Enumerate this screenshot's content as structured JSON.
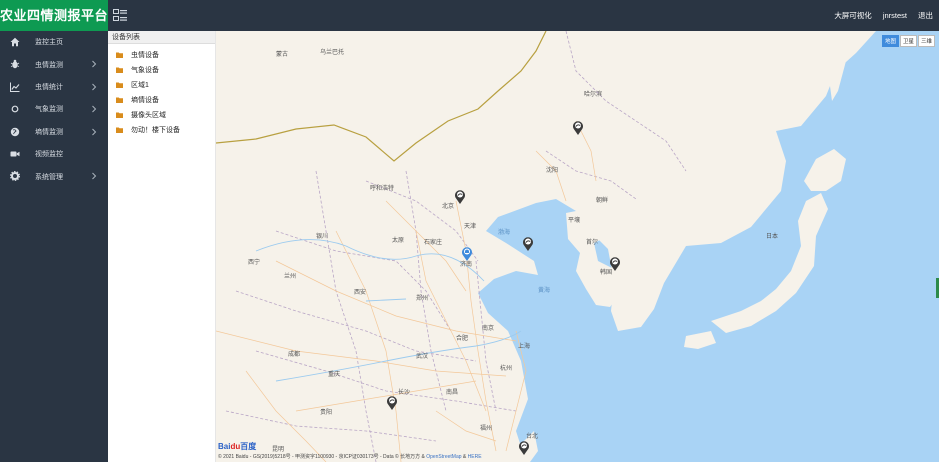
{
  "brand": {
    "title": "农业四情测报平台"
  },
  "header": {
    "links": [
      "大屏可视化",
      "jnrstest",
      "退出"
    ]
  },
  "sidebar": {
    "items": [
      {
        "label": "监控主页",
        "icon": "home-icon",
        "has_submenu": false
      },
      {
        "label": "虫情监测",
        "icon": "bug-icon",
        "has_submenu": true
      },
      {
        "label": "虫情统计",
        "icon": "line-chart-icon",
        "has_submenu": true
      },
      {
        "label": "气象监测",
        "icon": "sun-icon",
        "has_submenu": true
      },
      {
        "label": "墒情监测",
        "icon": "globe-icon",
        "has_submenu": true
      },
      {
        "label": "视频监控",
        "icon": "video-camera-icon",
        "has_submenu": false
      },
      {
        "label": "系统管理",
        "icon": "gear-icon",
        "has_submenu": true
      }
    ]
  },
  "device_panel": {
    "title": "设备列表",
    "items": [
      "虫情设备",
      "气象设备",
      "区域1",
      "墒情设备",
      "摄像头区域",
      "勿动！楼下设备"
    ]
  },
  "map": {
    "map_types": [
      "地图",
      "卫星",
      "三维"
    ],
    "active_map_type": "地图",
    "labels": {
      "cities": [
        "蒙古",
        "乌兰巴托",
        "哈尔滨",
        "沈阳",
        "呼和浩特",
        "北京",
        "天津",
        "朝鲜",
        "韩国",
        "日本",
        "太原",
        "石家庄",
        "银川",
        "西宁",
        "兰州",
        "济南",
        "西安",
        "郑州",
        "合肥",
        "南京",
        "上海",
        "成都",
        "武汉",
        "杭州",
        "重庆",
        "长沙",
        "南昌",
        "贵阳",
        "福州",
        "昆明",
        "台北",
        "平壤",
        "首尔"
      ],
      "seas": [
        "渤海",
        "黄海"
      ]
    },
    "copyright": "© 2021 Baidu - GS(2019)5218号 - 甲测资字1100930 - 京ICP证030173号 - Data © 长地万方 & ",
    "copyright_osm": "OpenStreetMap",
    "copyright_and": " & ",
    "copyright_here": "HERE",
    "baidu_logo_a": "Bai",
    "baidu_logo_b": "du",
    "baidu_logo_c": "百度"
  },
  "colors": {
    "brand_green": "#0e9a52",
    "nav_bg": "#2a3543",
    "sea": "#a9d3f5",
    "land": "#f6f2ea",
    "active_marker": "#3f8bdc",
    "folder": "#d98c1c"
  }
}
